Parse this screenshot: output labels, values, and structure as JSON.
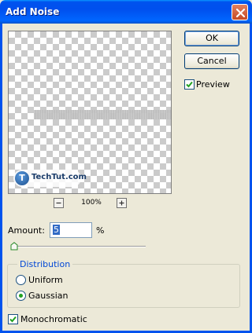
{
  "window": {
    "title": "Add Noise"
  },
  "buttons": {
    "ok": "OK",
    "cancel": "Cancel"
  },
  "preview": {
    "label": "Preview",
    "checked": true,
    "watermark": "TechTut.com",
    "zoom": "100%"
  },
  "amount": {
    "label": "Amount:",
    "value": "5",
    "unit": "%",
    "slider_percent": 1
  },
  "distribution": {
    "legend": "Distribution",
    "options": [
      "Uniform",
      "Gaussian"
    ],
    "selected": "Gaussian"
  },
  "monochromatic": {
    "label": "Monochromatic",
    "checked": true
  },
  "icons": {
    "close": "close-icon",
    "zoom_out": "minus-icon",
    "zoom_in": "plus-icon",
    "check": "checkmark-icon",
    "slider": "slider-thumb-icon"
  },
  "colors": {
    "titlebar": "#0053ee",
    "legend": "#0046d5",
    "radio_dot": "#21a121"
  }
}
